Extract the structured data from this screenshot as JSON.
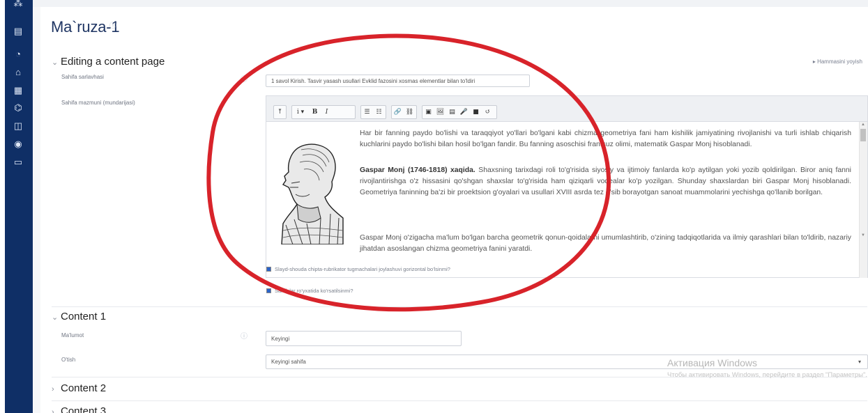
{
  "page": {
    "title": "Ma`ruza-1"
  },
  "rail": {
    "icons": [
      "course-icon",
      "book-icon",
      "dashboard-icon",
      "home-icon",
      "calendar-icon",
      "graduation-icon",
      "files-icon",
      "globe-icon",
      "folder-icon"
    ]
  },
  "header": {
    "expand_all": "▸ Hammasini yoyish"
  },
  "section_general": {
    "heading": "Editing a content page",
    "title_label": "Sahifa sarlavhasi",
    "title_value": "1 savol Kirish. Tasvir yasash usullari Evklid fazosini xosmas elementlar bilan to'ldiri",
    "content_label": "Sahifa mazmuni (mundarijasi)",
    "toolbar_buttons": [
      "⤒",
      "i ▾",
      "B",
      "I",
      "☰",
      "☷",
      "🔗",
      "⛓",
      "▣",
      "🖼",
      "▤",
      "🎤",
      "■",
      "↺"
    ]
  },
  "editor": {
    "p1": "Har bir fanning paydo bo'lishi va taraqqiyot yo'llari bo'lgani kabi chizma geometriya fani ham kishilik jamiyatining rivojlanishi va turli ishlab chiqarish kuchlarini paydo bo'lishi bilan hosil bo'lgan fandir. Bu fanning asoschisi frantsuz olimi, matematik Gaspar Monj hisoblanadi.",
    "p2_bold": "Gaspar Monj (1746-1818) xaqida.",
    "p2": " Shaxsning tarixdagi roli to'g'risida siyosiy va ijtimoiy fanlarda ko'p aytilgan yoki yozib qoldirilgan. Biror aniq fanni rivojlantirishga o'z hissasini qo'shgan shaxslar to'g'risida ham qiziqarli voqealar ko'p yozilgan. Shunday shaxslardan biri Gaspar Monj hisoblanadi. Geometriya faninning ba'zi bir proektsion g'oyalari va usullari XVIII asrda tez o'sib borayotgan sanoat muammolarini yechishga qo'llanib borilgan.",
    "p3": "Gaspar Monj o'zigacha ma'lum bo'lgan barcha geometrik qonun-qoidalarni umumlashtirib, o'zining tadqiqotlarida va ilmiy qarashlari bilan to'ldirib, nazariy jihatdan asoslangan chizma geometriya fanini yaratdi."
  },
  "checkboxes": [
    {
      "label": "Slayd-shouda chipta-rubrikator tugmachalari joylashuvi gorizontal bo'lsinmi?",
      "checked": true
    },
    {
      "label": "Sahifalar ro'yxatida ko'rsatilsinmi?",
      "checked": true
    }
  ],
  "content1": {
    "heading": "Content 1",
    "info_label": "Ma'lumot",
    "info_value": "Keyingi",
    "jump_label": "O'tish",
    "jump_value": "Keyingi sahifa"
  },
  "content2": {
    "heading": "Content 2"
  },
  "content3": {
    "heading": "Content 3"
  },
  "watermark": {
    "title": "Активация Windows",
    "subtitle": "Чтобы активировать Windows, перейдите в раздел \"Параметры\"."
  },
  "annotation_color": "#d8232a"
}
